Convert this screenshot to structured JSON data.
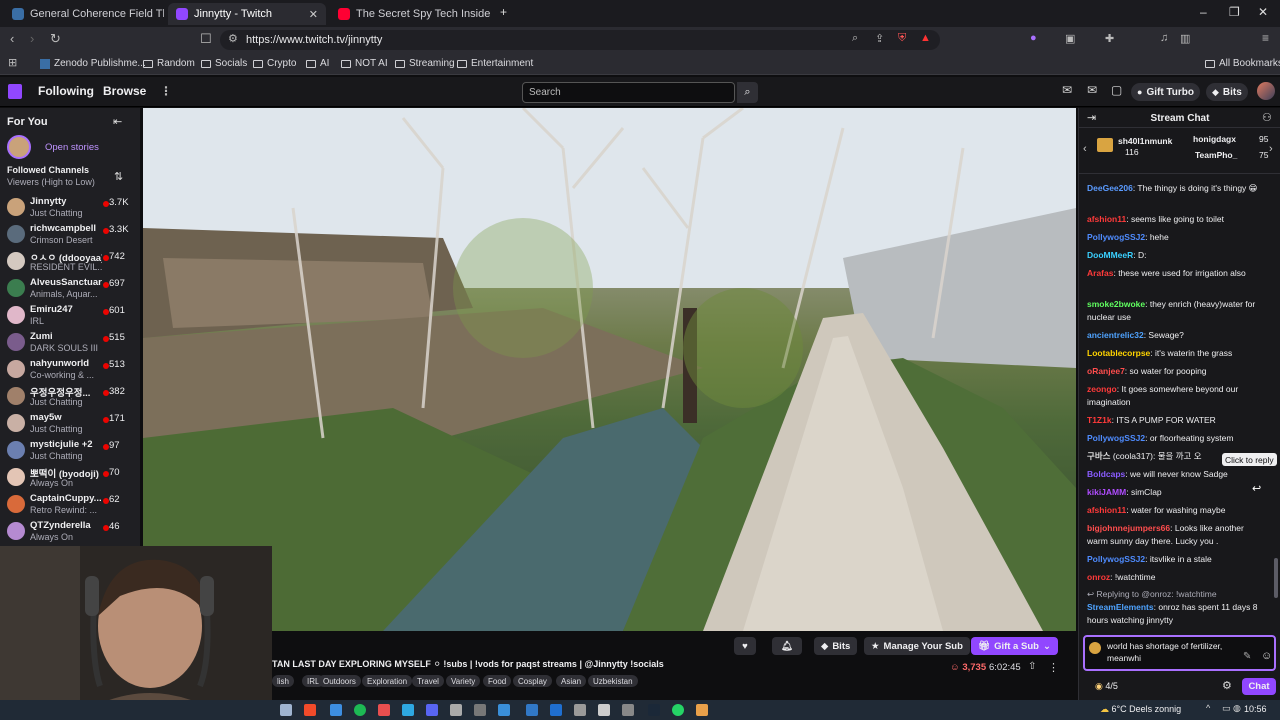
{
  "browser": {
    "tabs": [
      {
        "label": "General Coherence Field Theory (GC",
        "icon": "zenodo-icon",
        "color": "#3a6ea5"
      },
      {
        "label": "Jinnytty - Twitch",
        "icon": "twitch-icon",
        "color": "#9147ff"
      },
      {
        "label": "The Secret Spy Tech Inside Every Cre",
        "icon": "youtube-icon",
        "color": "#ff0033"
      }
    ],
    "url": "https://www.twitch.tv/jinnytty",
    "bookmarks": [
      "Zenodo Publishme...",
      "Random",
      "Socials",
      "Crypto",
      "AI",
      "NOT AI",
      "Streaming",
      "Entertainment"
    ],
    "all_bookmarks": "All Bookmarks"
  },
  "twitch_nav": {
    "following": "Following",
    "browse": "Browse",
    "search_placeholder": "Search",
    "gift_turbo": "Gift Turbo",
    "bits": "Bits"
  },
  "sidebar": {
    "for_you": "For You",
    "open_stories": "Open stories",
    "followed_title": "Followed Channels",
    "followed_sort": "Viewers (High to Low)",
    "channels": [
      {
        "name": "Jinnytty",
        "game": "Just Chatting",
        "viewers": "3.7K",
        "color": "#c9a27a"
      },
      {
        "name": "richwcampbell",
        "game": "Crimson Desert",
        "viewers": "3.3K",
        "color": "#5a6b7c"
      },
      {
        "name": "ㅇㅅㅇ (ddooyaa)",
        "game": "RESIDENT EVIL...",
        "viewers": "742",
        "color": "#d4c9c0"
      },
      {
        "name": "AlveusSanctuary",
        "game": "Animals, Aquar...",
        "viewers": "697",
        "color": "#3b7d4f"
      },
      {
        "name": "Emiru247",
        "game": "IRL",
        "viewers": "601",
        "color": "#e0b7c9"
      },
      {
        "name": "Zumi",
        "game": "DARK SOULS III",
        "viewers": "515",
        "color": "#7a5c8c"
      },
      {
        "name": "nahyunworld",
        "game": "Co-working & ...",
        "viewers": "513",
        "color": "#c7a8a0"
      },
      {
        "name": "우정우정우정...",
        "game": "Just Chatting",
        "viewers": "382",
        "color": "#a0806a"
      },
      {
        "name": "may5w",
        "game": "Just Chatting",
        "viewers": "171",
        "color": "#c9b0a5"
      },
      {
        "name": "mysticjulie +2",
        "game": "Just Chatting",
        "viewers": "97",
        "color": "#6b7fb0"
      },
      {
        "name": "뽀떡이 (byodoji)",
        "game": "Always On",
        "viewers": "70",
        "color": "#e3c5b5"
      },
      {
        "name": "CaptainCuppy...",
        "game": "Retro Rewind: ...",
        "viewers": "62",
        "color": "#d96a3a"
      },
      {
        "name": "QTZynderella",
        "game": "Always On",
        "viewers": "46",
        "color": "#b58ad1"
      }
    ]
  },
  "stream": {
    "title": "TAN LAST DAY EXPLORING MYSELF ⚪ !subs | !vods for paqst streams | @Jinnytty !socials",
    "tags": [
      "lish",
      "IRL",
      "Outdoors",
      "Exploration",
      "Travel",
      "Variety",
      "Food",
      "Cosplay",
      "Asian",
      "Uzbekistan"
    ],
    "bits_label": "Bits",
    "manage_sub": "Manage Your Sub",
    "gift_sub": "Gift a Sub",
    "viewers": "3,735",
    "uptime": "6:02:45"
  },
  "chat": {
    "title": "Stream Chat",
    "gifters": [
      {
        "name": "sh40l1nmunk",
        "count": "116"
      },
      {
        "name": "honigdagx",
        "count": "95"
      },
      {
        "name": "TeamPho_",
        "count": "75"
      }
    ],
    "messages": [
      {
        "user": "DeeGee206",
        "color": "#5b9bff",
        "text": ": The thingy is doing it's thingy 😁"
      },
      {
        "user": "afshion11",
        "color": "#ff3a3a",
        "text": ": seems like going to toilet"
      },
      {
        "user": "PollywogSSJ2",
        "color": "#4f8cff",
        "text": ": hehe"
      },
      {
        "user": "DooMMeeR",
        "color": "#3ad0ff",
        "text": ": D:"
      },
      {
        "user": "Arafas",
        "color": "#ff3a3a",
        "text": ": these were used for irrigation also"
      },
      {
        "user": "smoke2bwoke",
        "color": "#60ff60",
        "text": ": they enrich (heavy)water for nuclear use"
      },
      {
        "user": "ancientrelic32",
        "color": "#4fa3ff",
        "text": ": Sewage?"
      },
      {
        "user": "Lootablecorpse",
        "color": "#ffd400",
        "text": ": it's waterin the grass"
      },
      {
        "user": "oRanjee7",
        "color": "#ff4d4d",
        "text": ": so water for pooping"
      },
      {
        "user": "zeongo",
        "color": "#ff3a3a",
        "text": ": It goes somewhere beyond our imagination"
      },
      {
        "user": "T1Z1k",
        "color": "#ff3a3a",
        "text": ": ITS A PUMP FOR WATER"
      },
      {
        "user": "PollywogSSJ2",
        "color": "#4f8cff",
        "text": ": or floorheating system"
      },
      {
        "user": "구바스",
        "color": "#dddddd",
        "text": " (coola317): 물을 까고 오"
      },
      {
        "user": "Boldcaps",
        "color": "#8a5cff",
        "text": ": we will never know Sadge"
      },
      {
        "user": "kikiJAMM",
        "color": "#b04cff",
        "text": ": simClap"
      },
      {
        "user": "afshion11",
        "color": "#ff3a3a",
        "text": ": water for washing maybe"
      },
      {
        "user": "bigjohnnejumpers66",
        "color": "#ff4d4d",
        "text": ": Looks like another warm sunny day there. Lucky you ."
      },
      {
        "user": "PollywogSSJ2",
        "color": "#4f8cff",
        "text": ": itsvlike in a stale"
      },
      {
        "user": "onroz",
        "color": "#ff3a3a",
        "text": ": !watchtime"
      }
    ],
    "reply_to": "Replying to @onroz: !watchtime",
    "bot_user": "StreamElements",
    "bot_text": ": onroz has spent 11 days 8 hours watching jinnytty",
    "tooltip": "Click to reply",
    "input_text": "world has shortage of fertilizer, meanwhi",
    "points": "4/5",
    "chat_button": "Chat"
  },
  "taskbar": {
    "weather": "6°C  Deels zonnig",
    "time": "10:56"
  }
}
